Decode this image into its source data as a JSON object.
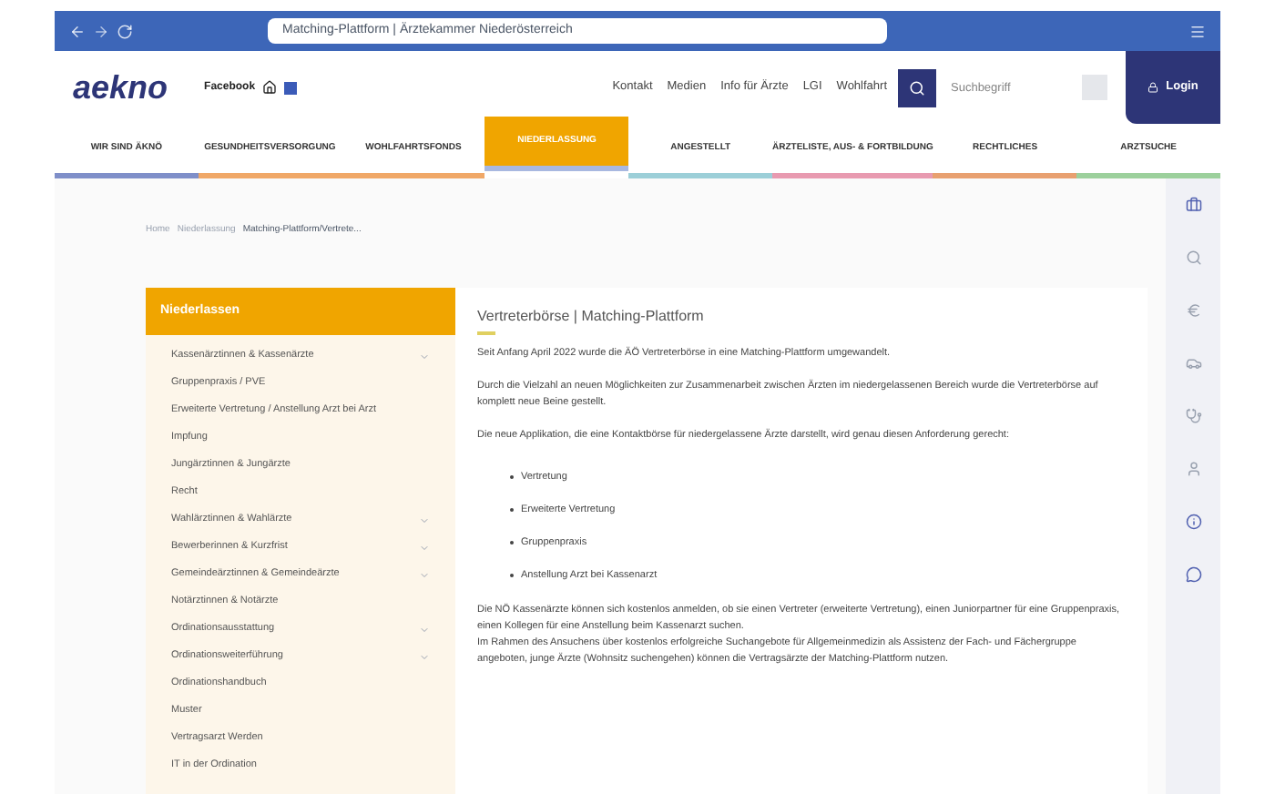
{
  "browser": {
    "address": "Matching-Plattform | Ärztekammer Niederösterreich"
  },
  "header": {
    "logo": "aekno",
    "social_label": "Facebook",
    "links": [
      "Kontakt",
      "Medien",
      "Info für Ärzte",
      "LGI",
      "Wohlfahrt"
    ],
    "search": {
      "placeholder": "Suchbegriff"
    },
    "login": "Login"
  },
  "nav": [
    {
      "label": "WIR SIND ÄKNÖ",
      "selected": false
    },
    {
      "label": "GESUNDHEITSVERSORGUNG",
      "selected": false
    },
    {
      "label": "WOHLFAHRTSFONDS",
      "selected": false
    },
    {
      "label": "NIEDERLASSUNG",
      "selected": true
    },
    {
      "label": "ANGESTELLT",
      "selected": false
    },
    {
      "label": "ÄRZTELISTE, AUS- & FORTBILDUNG",
      "selected": false
    },
    {
      "label": "RECHTLICHES",
      "selected": false
    },
    {
      "label": "ARZTSUCHE",
      "selected": false
    }
  ],
  "breadcrumb": [
    "Home",
    "Niederlassung",
    "Matching-Plattform/Vertrete..."
  ],
  "sidebar": {
    "title": "Niederlassen",
    "items": [
      {
        "label": "Kassenärztinnen & Kassenärzte",
        "expandable": true
      },
      {
        "label": "Gruppenpraxis / PVE",
        "expandable": false
      },
      {
        "label": "Erweiterte Vertretung / Anstellung Arzt bei Arzt",
        "expandable": false
      },
      {
        "label": "Impfung",
        "expandable": false
      },
      {
        "label": "Jungärztinnen & Jungärzte",
        "expandable": false
      },
      {
        "label": "Recht",
        "expandable": false
      },
      {
        "label": "Wahlärztinnen & Wahlärzte",
        "expandable": true
      },
      {
        "label": "Bewerberinnen & Kurzfrist",
        "expandable": true
      },
      {
        "label": "Gemeindeärztinnen & Gemeindeärzte",
        "expandable": true
      },
      {
        "label": "Notärztinnen & Notärzte",
        "expandable": false
      },
      {
        "label": "Ordinationsausstattung",
        "expandable": true
      },
      {
        "label": "Ordinationsweiterführung",
        "expandable": true
      },
      {
        "label": "Ordinationshandbuch",
        "expandable": false
      },
      {
        "label": "Muster",
        "expandable": false
      },
      {
        "label": "Vertragsarzt Werden",
        "expandable": false
      },
      {
        "label": "IT in der Ordination",
        "expandable": false
      }
    ]
  },
  "article": {
    "title": "Vertreterbörse | Matching-Plattform",
    "paragraphs": [
      "Seit Anfang April 2022 wurde die ÄÖ Vertreterbörse in eine Matching-Plattform umgewandelt.",
      "Durch die Vielzahl an neuen Möglichkeiten zur Zusammenarbeit zwischen Ärzten im niedergelassenen Bereich wurde die Vertreterbörse auf komplett neue Beine gestellt.",
      "Die neue Applikation, die eine Kontaktbörse für niedergelassene Ärzte darstellt, wird genau diesen Anforderung gerecht:"
    ],
    "bullets": [
      "Vertretung",
      "Erweiterte Vertretung",
      "Gruppenpraxis",
      "Anstellung Arzt bei Kassenarzt"
    ],
    "closing": [
      "Die NÖ Kassenärzte können sich kostenlos anmelden, ob sie einen Vertreter (erweiterte Vertretung), einen Juniorpartner für eine Gruppenpraxis, einen Kollegen für eine Anstellung beim Kassenarzt suchen.",
      "Im Rahmen des Ansuchens über kostenlos erfolgreiche Suchangebote für Allgemeinmedizin als Assistenz der Fach- und Fächergruppe angeboten, junge Ärzte (Wohnsitz suchengehen) können die Vertragsärzte der Matching-Plattform nutzen."
    ]
  }
}
